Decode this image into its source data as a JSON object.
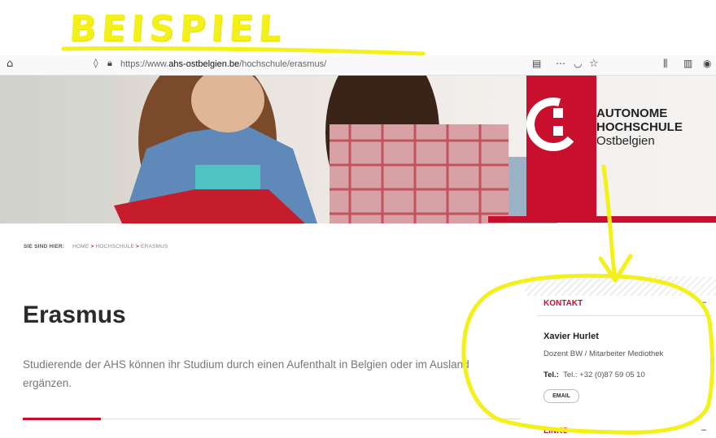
{
  "annotation": {
    "label": "BEISPIEL",
    "color": "#f4f01a"
  },
  "browser": {
    "url_prefix": "https://www.",
    "url_domain": "ahs-ostbelgien.be",
    "url_path": "/hochschule/erasmus/",
    "icons": [
      "home-icon",
      "shield-icon",
      "lock-icon",
      "reader-icon",
      "more-icon",
      "pocket-icon",
      "star-icon",
      "library-icon",
      "sidebar-icon",
      "account-icon"
    ]
  },
  "logo": {
    "line1": "AUTONOME",
    "line2": "HOCHSCHULE",
    "line3": "Ostbelgien",
    "brand_color": "#c8102e"
  },
  "breadcrumb": {
    "label": "SIE SIND HIER:",
    "items": [
      "HOME",
      "HOCHSCHULE",
      "ERASMUS"
    ],
    "separator": ">"
  },
  "main": {
    "title": "Erasmus",
    "lead": "Studierende der AHS können ihr Studium durch einen Aufenthalt in Belgien oder im Ausland ergänzen."
  },
  "sidebar": {
    "kontakt_title": "KONTAKT",
    "toggle": "–",
    "name": "Xavier Hurlet",
    "role": "Dozent BW / Mitarbeiter Mediothek",
    "tel_label": "Tel.:",
    "tel_value": "Tel.: +32 (0)87 59 05 10",
    "email_button": "EMAIL",
    "links_title": "LINKS",
    "links_toggle": "–"
  }
}
